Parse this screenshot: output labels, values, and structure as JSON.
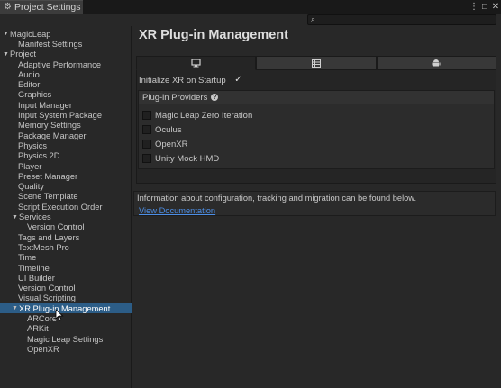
{
  "window": {
    "tab_title": "Project Settings",
    "menu_glyph": "⋮",
    "maximize_glyph": "□",
    "close_glyph": "✕"
  },
  "search": {
    "placeholder": "",
    "value": ""
  },
  "sidebar": {
    "items": [
      {
        "label": "MagicLeap",
        "level": 0,
        "expanded": true
      },
      {
        "label": "Manifest Settings",
        "level": 1
      },
      {
        "label": "Project",
        "level": 0,
        "expanded": true
      },
      {
        "label": "Adaptive Performance",
        "level": 1
      },
      {
        "label": "Audio",
        "level": 1
      },
      {
        "label": "Editor",
        "level": 1
      },
      {
        "label": "Graphics",
        "level": 1
      },
      {
        "label": "Input Manager",
        "level": 1
      },
      {
        "label": "Input System Package",
        "level": 1
      },
      {
        "label": "Memory Settings",
        "level": 1
      },
      {
        "label": "Package Manager",
        "level": 1
      },
      {
        "label": "Physics",
        "level": 1
      },
      {
        "label": "Physics 2D",
        "level": 1
      },
      {
        "label": "Player",
        "level": 1
      },
      {
        "label": "Preset Manager",
        "level": 1
      },
      {
        "label": "Quality",
        "level": 1
      },
      {
        "label": "Scene Template",
        "level": 1
      },
      {
        "label": "Script Execution Order",
        "level": 1
      },
      {
        "label": "Services",
        "level": 1,
        "expanded": true
      },
      {
        "label": "Version Control",
        "level": 2
      },
      {
        "label": "Tags and Layers",
        "level": 1
      },
      {
        "label": "TextMesh Pro",
        "level": 1
      },
      {
        "label": "Time",
        "level": 1
      },
      {
        "label": "Timeline",
        "level": 1
      },
      {
        "label": "UI Builder",
        "level": 1
      },
      {
        "label": "Version Control",
        "level": 1
      },
      {
        "label": "Visual Scripting",
        "level": 1
      },
      {
        "label": "XR Plug-in Management",
        "level": 1,
        "expanded": true,
        "selected": true
      },
      {
        "label": "ARCore",
        "level": 2
      },
      {
        "label": "ARKit",
        "level": 2
      },
      {
        "label": "Magic Leap Settings",
        "level": 2
      },
      {
        "label": "OpenXR",
        "level": 2
      }
    ]
  },
  "main": {
    "title": "XR Plug-in Management",
    "platform_tabs": [
      {
        "icon": "monitor-icon",
        "active": true
      },
      {
        "icon": "grid-icon",
        "active": false
      },
      {
        "icon": "android-icon",
        "active": false
      }
    ],
    "init_label": "Initialize XR on Startup",
    "init_checked": true,
    "providers_header": "Plug-in Providers",
    "help_glyph": "?",
    "providers": [
      {
        "label": "Magic Leap Zero Iteration",
        "checked": false
      },
      {
        "label": "Oculus",
        "checked": false
      },
      {
        "label": "OpenXR",
        "checked": false
      },
      {
        "label": "Unity Mock HMD",
        "checked": false
      }
    ],
    "info_text": "Information about configuration, tracking and migration can be found below.",
    "doc_link": "View Documentation"
  },
  "colors": {
    "selection": "#2c5d87",
    "link": "#4c8ee6",
    "background": "#282828"
  }
}
